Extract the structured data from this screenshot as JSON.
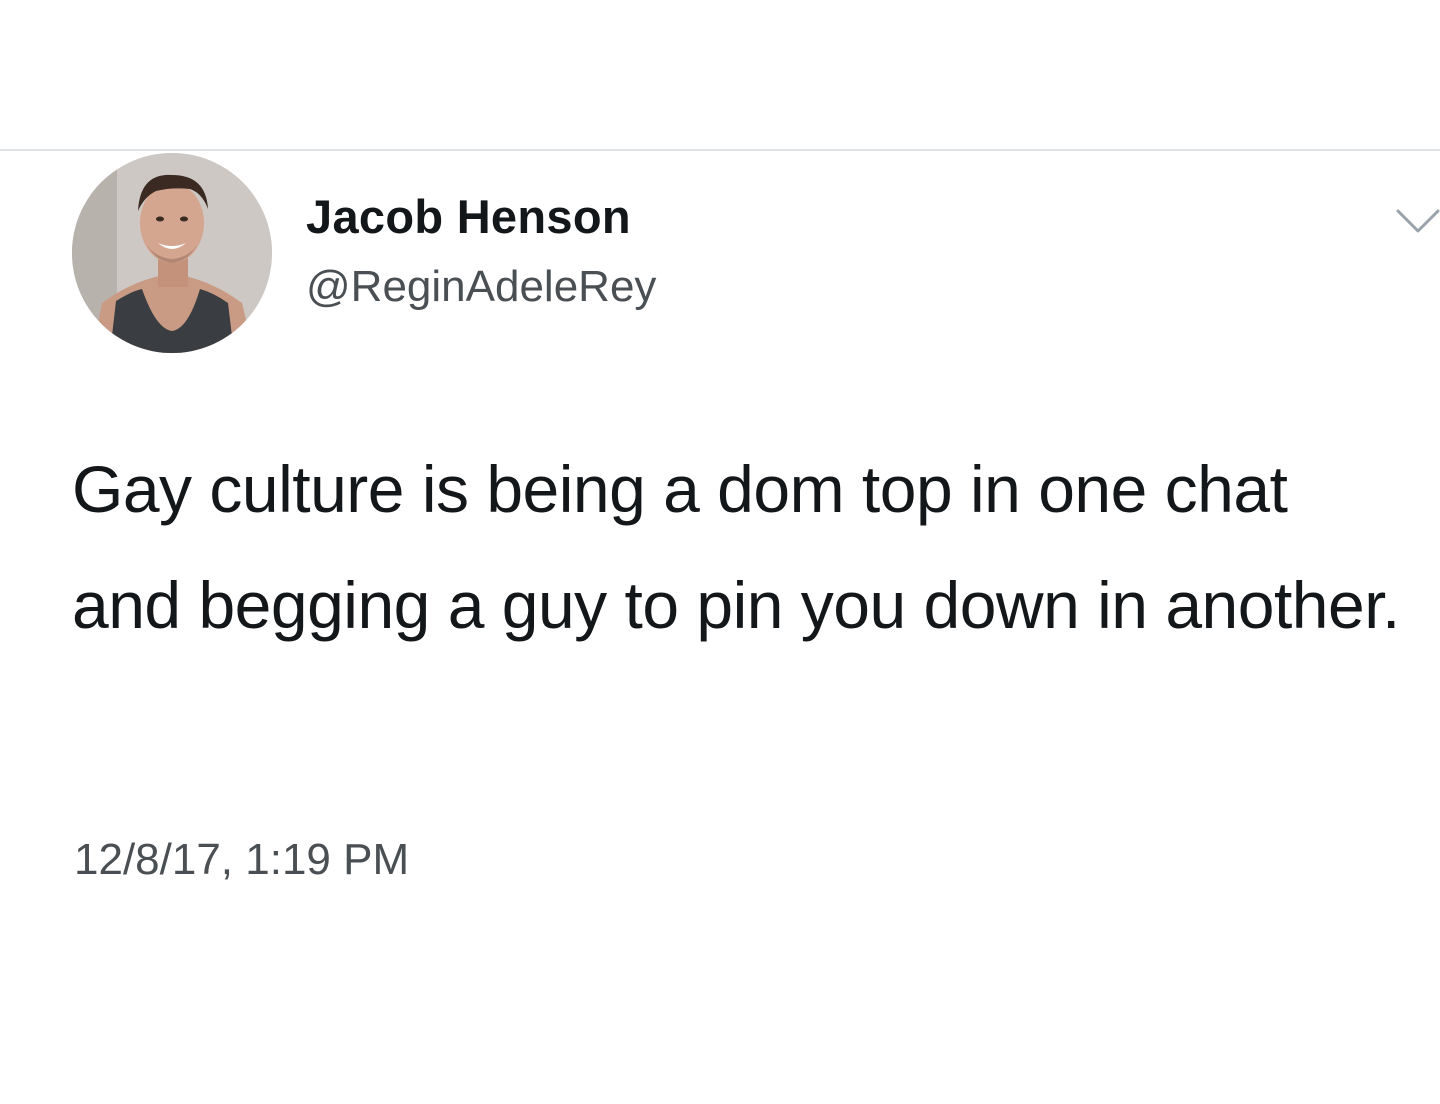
{
  "tweet": {
    "author": {
      "display_name": "Jacob Henson",
      "handle": "@ReginAdeleRey",
      "avatar_icon": "profile-photo"
    },
    "text": "Gay culture is being a dom top in one chat and begging a guy to pin you down in another.",
    "timestamp": "12/8/17, 1:19 PM",
    "menu_icon": "chevron-down-icon"
  },
  "colors": {
    "background": "#ffffff",
    "primary_text": "#14171a",
    "secondary_text": "#4a4f54",
    "divider": "#dfe3e6"
  }
}
